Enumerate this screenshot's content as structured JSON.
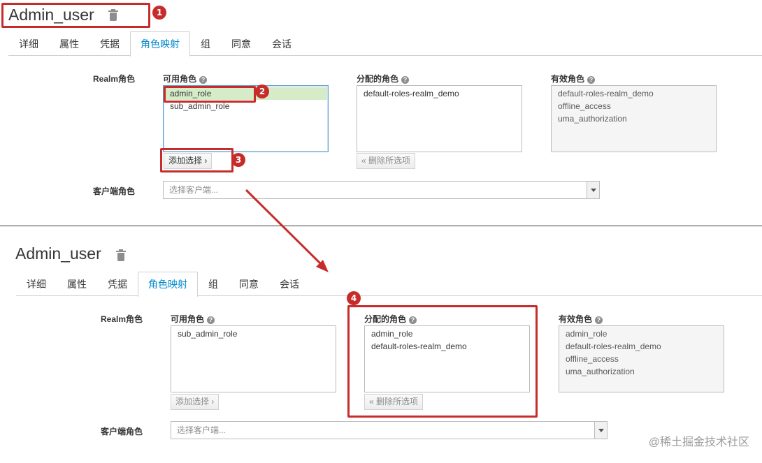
{
  "user_title": "Admin_user",
  "tabs": [
    "详细",
    "属性",
    "凭据",
    "角色映射",
    "组",
    "同意",
    "会话"
  ],
  "active_tab": "角色映射",
  "labels": {
    "realm_roles": "Realm角色",
    "available_roles": "可用角色",
    "assigned_roles": "分配的角色",
    "effective_roles": "有效角色",
    "client_roles": "客户端角色",
    "help_mark": "?"
  },
  "buttons": {
    "add_selected": "添加选择 ›",
    "remove_selected": "« 删除所选项"
  },
  "client_select_placeholder": "选择客户端...",
  "before": {
    "available": [
      "admin_role",
      "sub_admin_role"
    ],
    "selected_available": "admin_role",
    "assigned": [
      "default-roles-realm_demo"
    ],
    "effective": [
      "default-roles-realm_demo",
      "offline_access",
      "uma_authorization"
    ]
  },
  "after": {
    "available": [
      "sub_admin_role"
    ],
    "assigned": [
      "admin_role",
      "default-roles-realm_demo"
    ],
    "effective": [
      "admin_role",
      "default-roles-realm_demo",
      "offline_access",
      "uma_authorization"
    ]
  },
  "step_badges": [
    "1",
    "2",
    "3",
    "4"
  ],
  "watermark": "@稀土掘金技术社区",
  "colors": {
    "accent": "#0088ce",
    "annotation_red": "#c62d2a",
    "selected_row": "#d6ecc9"
  }
}
